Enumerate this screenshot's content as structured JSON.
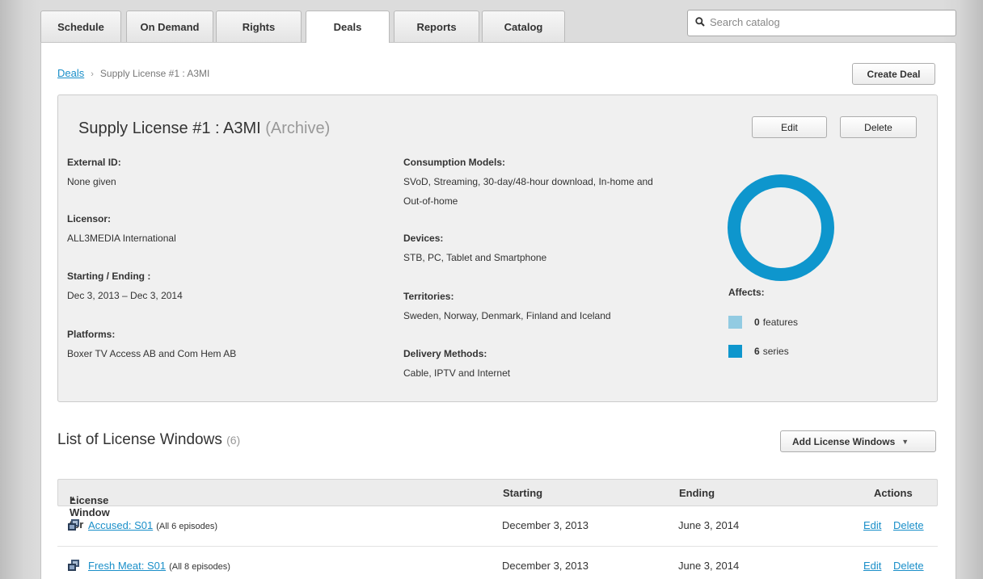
{
  "nav": {
    "tabs": [
      {
        "label": "Schedule",
        "active": false
      },
      {
        "label": "On Demand",
        "active": false
      },
      {
        "label": "Rights",
        "active": false
      },
      {
        "label": "Deals",
        "active": true
      },
      {
        "label": "Reports",
        "active": false
      },
      {
        "label": "Catalog",
        "active": false
      }
    ],
    "search_placeholder": "Search catalog",
    "search_icon": "magnifier-icon"
  },
  "breadcrumb": {
    "parent": "Deals",
    "separator": "›",
    "current": "Supply License #1 : A3MI"
  },
  "create_deal_label": "Create Deal",
  "deal": {
    "title": "Supply License #1 : A3MI",
    "status": "(Archive)",
    "edit_label": "Edit",
    "delete_label": "Delete",
    "fields_left": [
      {
        "label": "External ID:",
        "value": "None given"
      },
      {
        "label": "Licensor:",
        "value": "ALL3MEDIA International"
      },
      {
        "label": "Starting / Ending :",
        "value": "Dec 3, 2013 – Dec 3, 2014"
      },
      {
        "label": "Platforms:",
        "value": "Boxer TV Access AB and Com Hem AB"
      }
    ],
    "consumption_label": "Consumption Models:",
    "consumption_line1": "SVoD, Streaming, 30-day/48-hour download, In-home and",
    "consumption_line2": "Out-of-home",
    "devices_label": "Devices:",
    "devices_value": "STB, PC, Tablet and Smartphone",
    "territories_label": "Territories:",
    "territories_value": "Sweden, Norway, Denmark, Finland and Iceland",
    "delivery_label": "Delivery Methods:",
    "delivery_value": "Cable, IPTV and Internet",
    "affects": {
      "label": "Affects:",
      "features_count": "0",
      "features_text": "features",
      "series_count": "6",
      "series_text": "series",
      "features_color": "#92cbe2",
      "series_color": "#0e96cd"
    }
  },
  "license_windows": {
    "title": "List of License Windows",
    "count": "(6)",
    "add_label": "Add License Windows",
    "columns": {
      "title": "License Window for",
      "starting": "Starting",
      "ending": "Ending",
      "actions": "Actions"
    },
    "rows": [
      {
        "name": "Accused: S01",
        "episodes": "(All 6 episodes)",
        "starting": "December 3, 2013",
        "ending": "June 3, 2014",
        "edit": "Edit",
        "delete": "Delete"
      },
      {
        "name": "Fresh Meat: S01",
        "episodes": "(All 8 episodes)",
        "starting": "December 3, 2013",
        "ending": "June 3, 2014",
        "edit": "Edit",
        "delete": "Delete"
      }
    ]
  },
  "chart_data": {
    "type": "pie",
    "categories": [
      "features",
      "series"
    ],
    "values": [
      0,
      6
    ],
    "colors": [
      "#92cbe2",
      "#0e96cd"
    ]
  }
}
